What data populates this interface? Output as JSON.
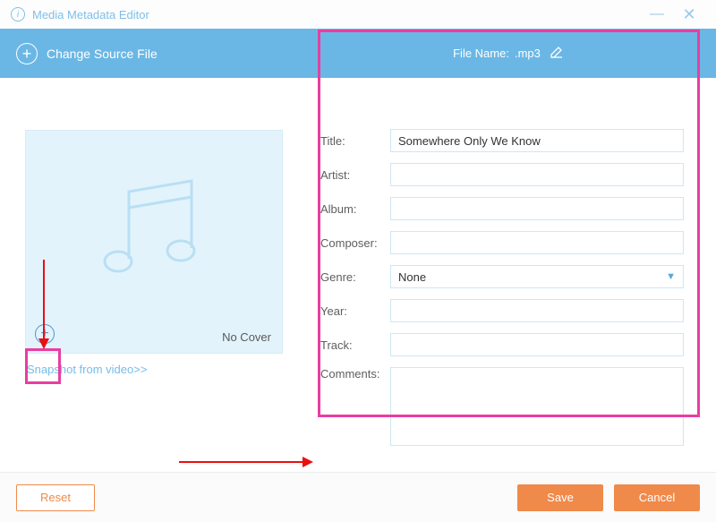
{
  "window": {
    "title": "Media Metadata Editor"
  },
  "header": {
    "change_source_label": "Change Source File",
    "file_name_label": "File Name:",
    "file_name_value": ".mp3"
  },
  "cover": {
    "no_cover_label": "No Cover",
    "snapshot_link": "Snapshot from video>>"
  },
  "form": {
    "title": {
      "label": "Title:",
      "value": "Somewhere Only We Know"
    },
    "artist": {
      "label": "Artist:",
      "value": ""
    },
    "album": {
      "label": "Album:",
      "value": ""
    },
    "composer": {
      "label": "Composer:",
      "value": ""
    },
    "genre": {
      "label": "Genre:",
      "value": "None"
    },
    "year": {
      "label": "Year:",
      "value": ""
    },
    "track": {
      "label": "Track:",
      "value": ""
    },
    "comments": {
      "label": "Comments:",
      "value": ""
    }
  },
  "footer": {
    "reset": "Reset",
    "save": "Save",
    "cancel": "Cancel"
  }
}
